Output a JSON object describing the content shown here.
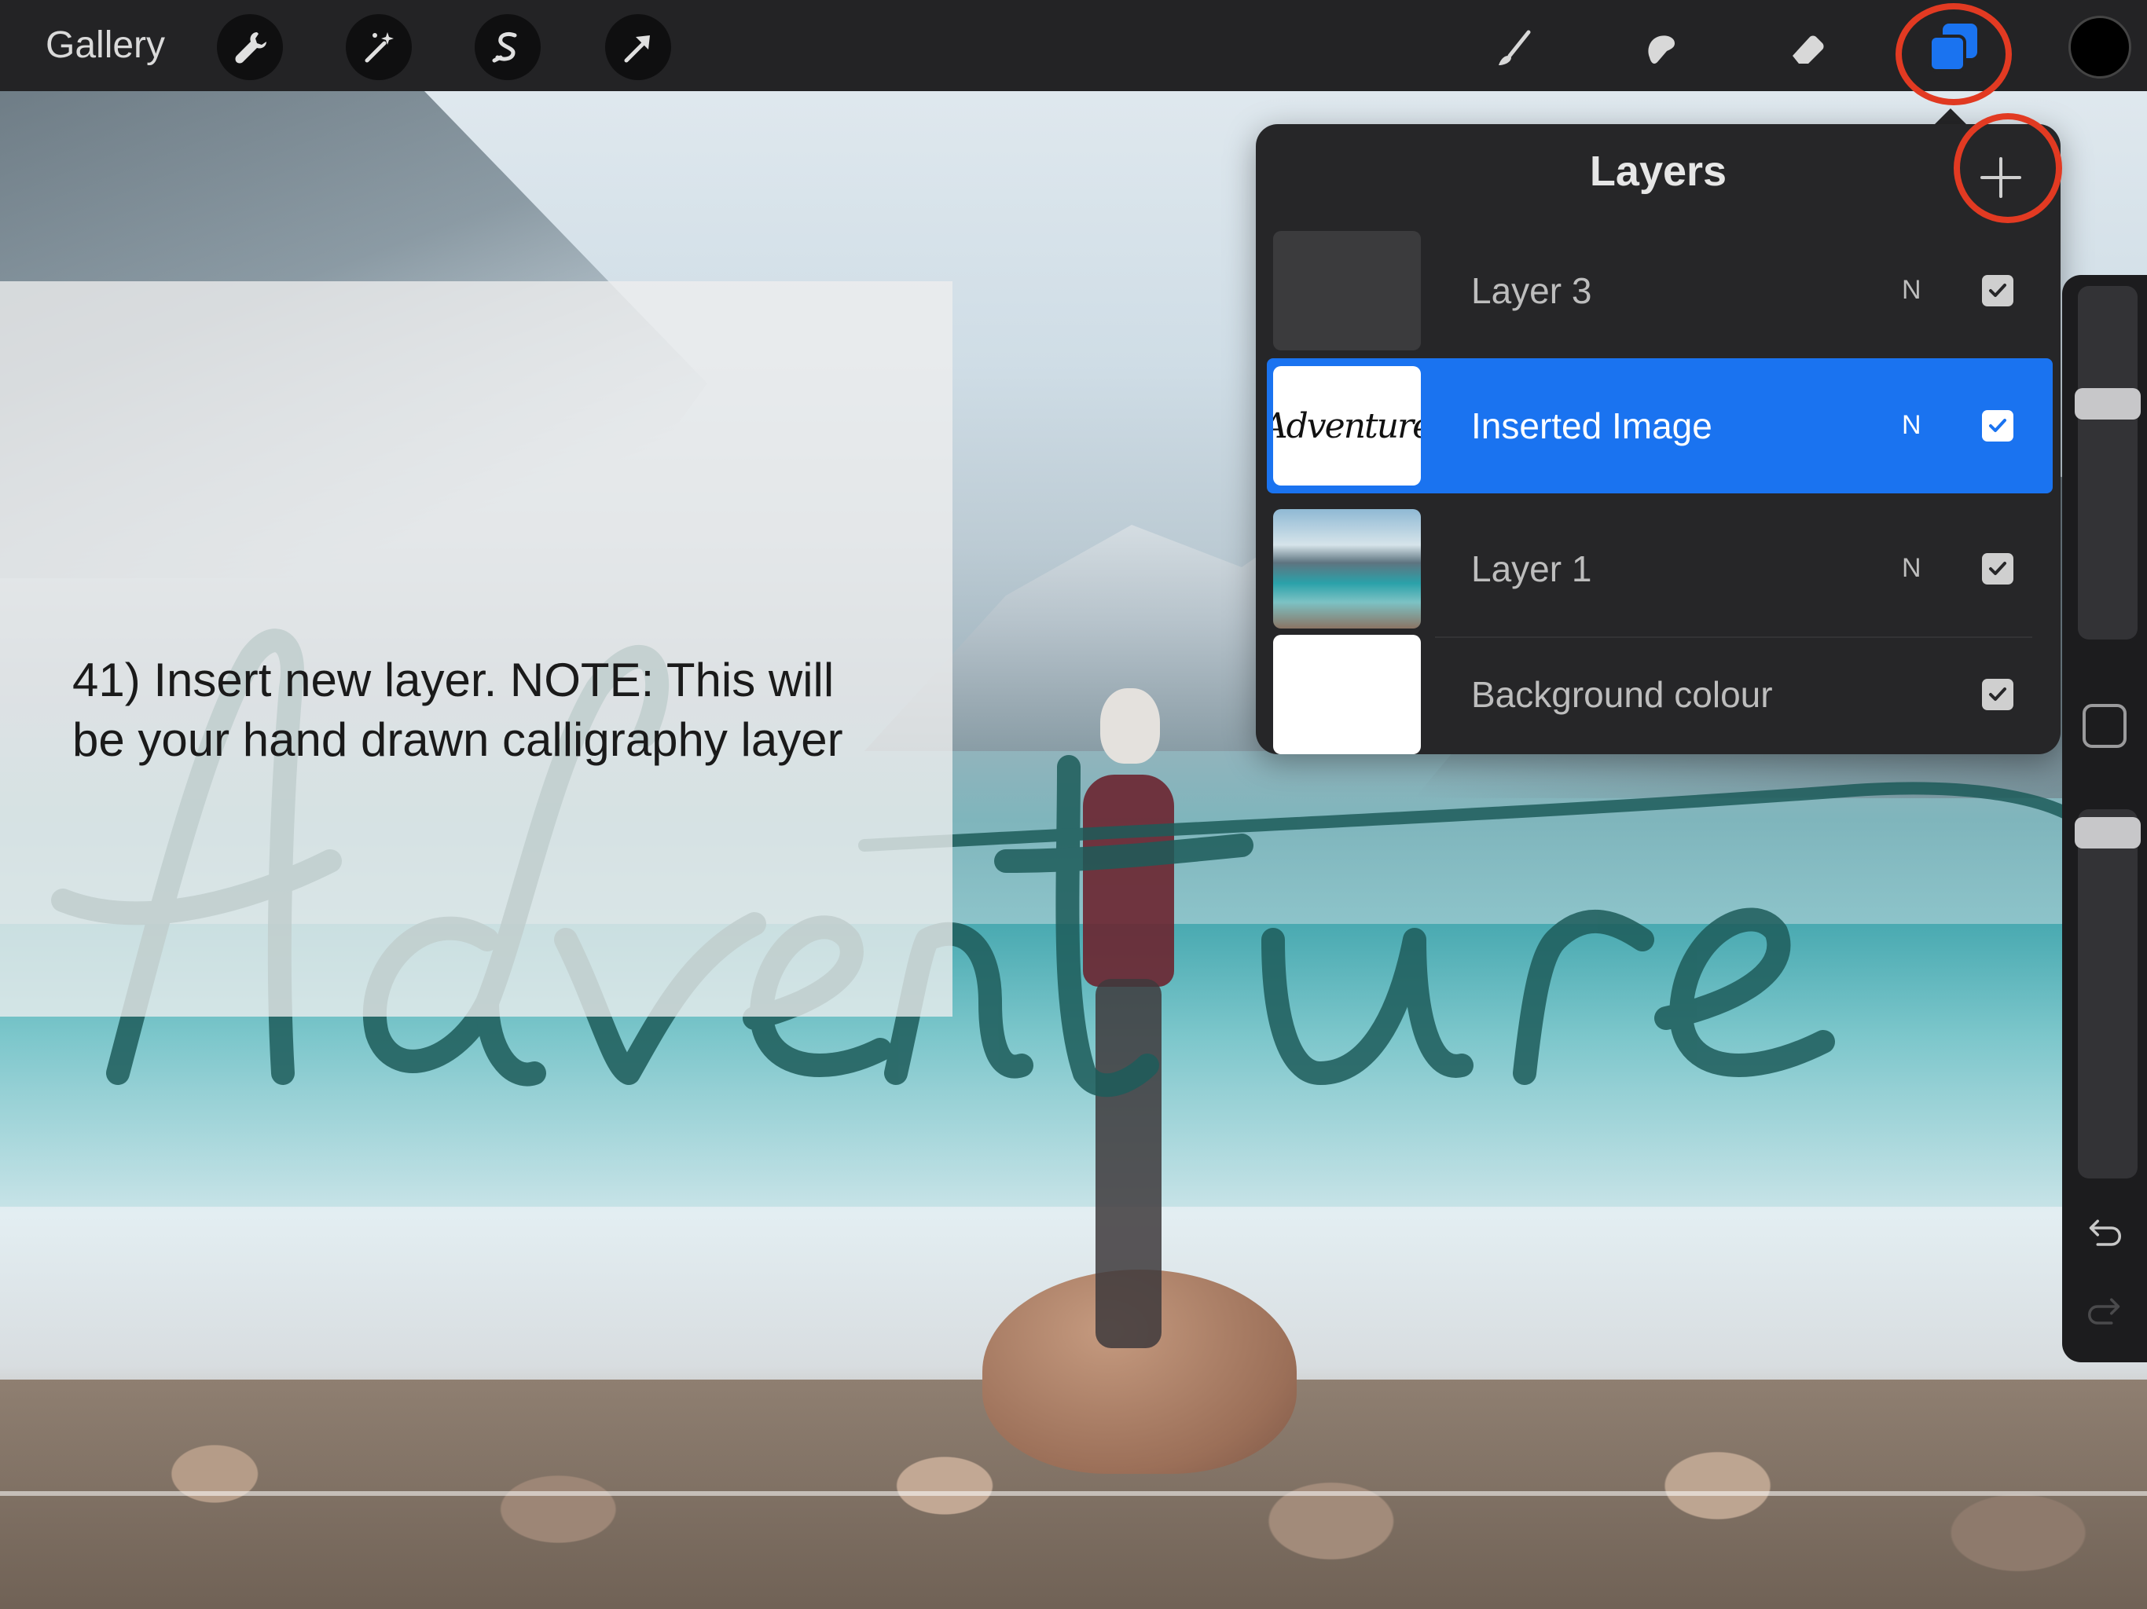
{
  "toolbar": {
    "gallery_label": "Gallery",
    "left_tools": [
      "wrench-icon",
      "magic-wand-icon",
      "selection-icon",
      "transform-arrow-icon"
    ],
    "right_tools": [
      "brush-icon",
      "smudge-icon",
      "eraser-icon",
      "layers-icon"
    ],
    "current_color": "#000000",
    "highlighted": "layers-icon"
  },
  "instruction": {
    "text_line1": "41) Insert new layer. NOTE: This will",
    "text_line2": "be your hand drawn calligraphy layer"
  },
  "canvas": {
    "lettering": "Adventure"
  },
  "layers_panel": {
    "title": "Layers",
    "add_button": "plus-icon",
    "add_button_highlighted": true,
    "layers": [
      {
        "name": "Layer 3",
        "blend": "N",
        "visible": true,
        "active": false,
        "thumbnail": "empty-layer"
      },
      {
        "name": "Inserted Image",
        "blend": "N",
        "visible": true,
        "active": true,
        "thumbnail": "adventure-lettering",
        "thumbnail_text": "Adventure"
      },
      {
        "name": "Layer 1",
        "blend": "N",
        "visible": true,
        "active": false,
        "thumbnail": "lake-photo"
      },
      {
        "name": "Background colour",
        "blend": "",
        "visible": true,
        "active": false,
        "thumbnail": "white"
      }
    ]
  },
  "sidebar": {
    "brush_size_level": 0.25,
    "opacity_level": 0.05,
    "undo_icon": "undo-icon",
    "redo_icon": "redo-icon"
  },
  "colors": {
    "toolbar_bg": "#232325",
    "panel_bg": "#262628",
    "active_layer": "#1a73f0",
    "highlight_ring": "#e23a22"
  }
}
